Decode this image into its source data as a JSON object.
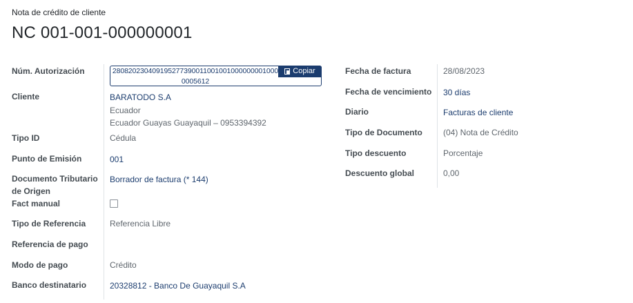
{
  "header": {
    "doc_type": "Nota de crédito de cliente",
    "title": "NC 001-001-000000001"
  },
  "left": {
    "auth_label": "Núm. Autorización",
    "auth_value": "2808202304091952773900110010010000000010000005612",
    "copy_label": "Copiar",
    "cliente_label": "Cliente",
    "cliente_name": "BARATODO S.A",
    "cliente_country": "Ecuador",
    "cliente_address": "Ecuador Guayas Guayaquil – 0953394392",
    "tipo_id_label": "Tipo ID",
    "tipo_id_value": "Cédula",
    "punto_label": "Punto de Emisión",
    "punto_value": "001",
    "doc_trib_label": "Documento Tributario de Origen",
    "doc_trib_value": "Borrador de factura (* 144)",
    "fact_manual_label": "Fact manual",
    "tipo_ref_label": "Tipo de Referencia",
    "tipo_ref_value": "Referencia Libre",
    "ref_pago_label": "Referencia de pago",
    "modo_pago_label": "Modo de pago",
    "modo_pago_value": "Crédito",
    "banco_label": "Banco destinatario",
    "banco_value": "20328812 - Banco De Guayaquil S.A"
  },
  "right": {
    "fecha_factura_label": "Fecha de factura",
    "fecha_factura_value": "28/08/2023",
    "fecha_venc_label": "Fecha de vencimiento",
    "fecha_venc_value": "30 días",
    "diario_label": "Diario",
    "diario_value": "Facturas de cliente",
    "tipo_doc_label": "Tipo de Documento",
    "tipo_doc_value": "(04) Nota de Crédito",
    "tipo_desc_label": "Tipo descuento",
    "tipo_desc_value": "Porcentaje",
    "desc_global_label": "Descuento global",
    "desc_global_value": "0,00"
  },
  "colors": {
    "link": "#1b3c6e",
    "text_muted": "#5f666d",
    "separator": "#dee2e6"
  }
}
